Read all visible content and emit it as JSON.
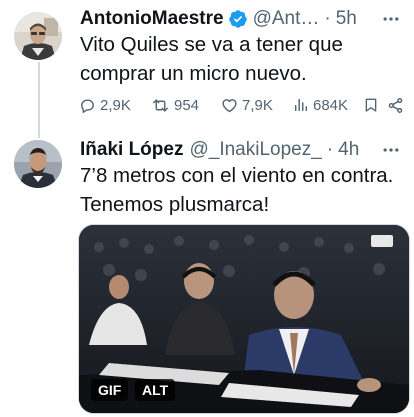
{
  "tweets": [
    {
      "display_name": "AntonioMaestre",
      "handle": "@Ant…",
      "separator": "·",
      "time": "5h",
      "text_lines": [
        "Vito Quiles se va a tener que",
        "comprar un micro nuevo."
      ],
      "stats": {
        "replies": "2,9K",
        "retweets": "954",
        "likes": "7,9K",
        "views": "684K"
      }
    },
    {
      "display_name": "Iñaki López",
      "handle": "@_InakiLopez_",
      "separator": "·",
      "time": "4h",
      "text_lines": [
        "7’8 metros con el viento en contra.",
        "Tenemos plusmarca!"
      ],
      "media": {
        "badge_gif": "GIF",
        "badge_alt": "ALT"
      }
    }
  ],
  "colors": {
    "text_primary": "#0f1419",
    "text_secondary": "#536471",
    "verified": "#1d9bf0",
    "thread_line": "#cfd9de"
  },
  "icons": {
    "verified": "verified-badge-icon",
    "more": "more-horizontal-icon",
    "reply": "reply-icon",
    "retweet": "retweet-icon",
    "like": "heart-icon",
    "views": "views-icon",
    "bookmark": "bookmark-icon",
    "share": "share-icon"
  }
}
